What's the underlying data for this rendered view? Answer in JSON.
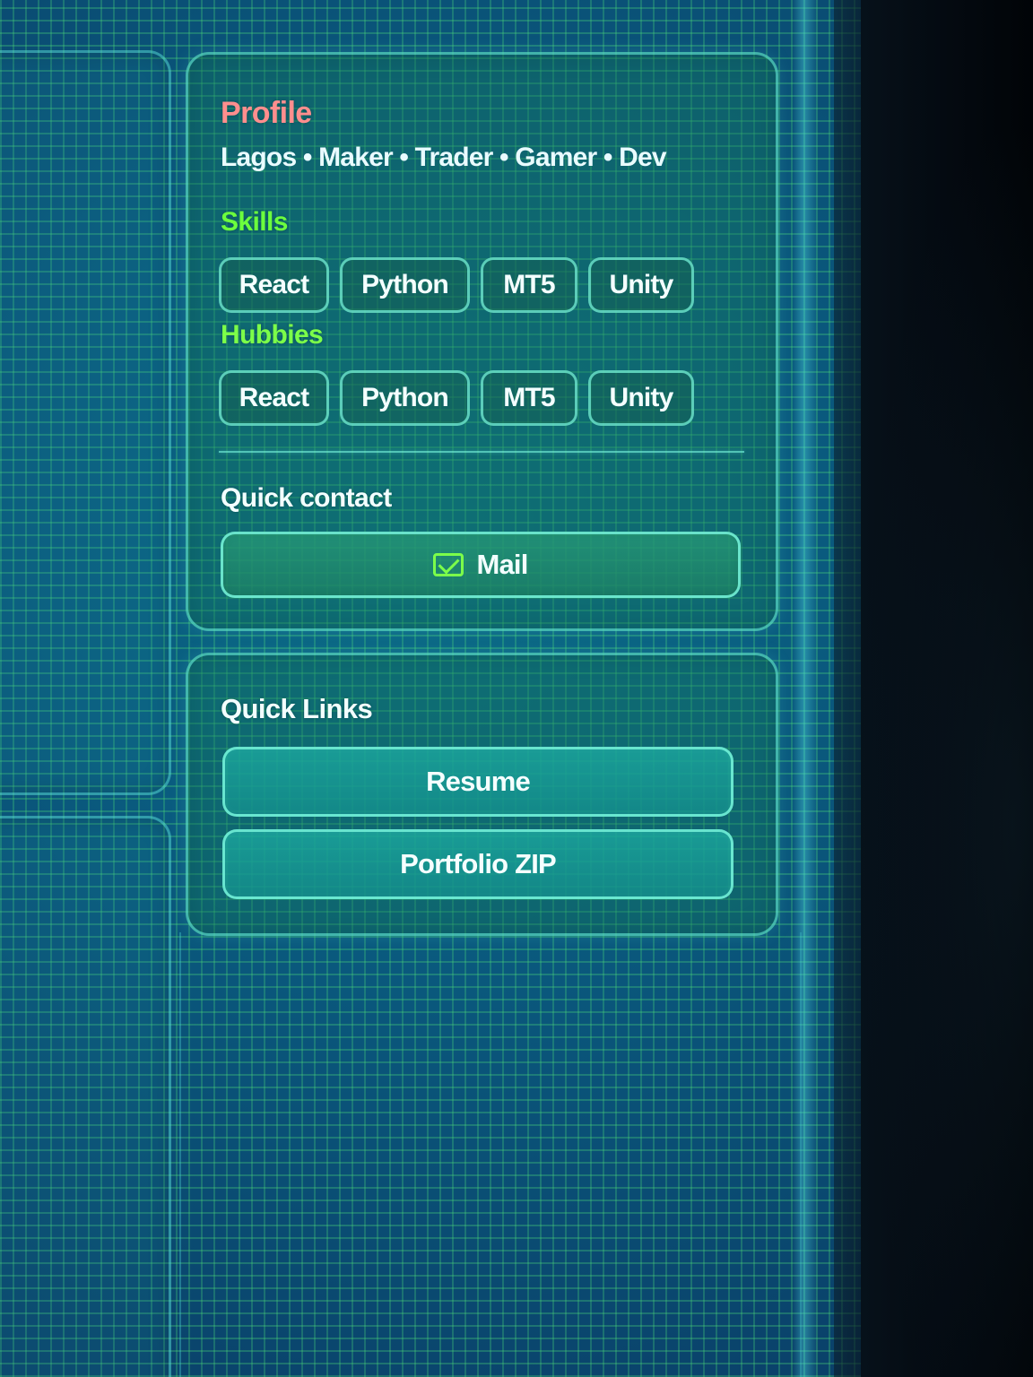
{
  "profile": {
    "title": "Profile",
    "tagline": "Lagos • Maker • Trader • Gamer • Dev",
    "skills_title": "Skills",
    "skills": [
      "React",
      "Python",
      "MT5",
      "Unity"
    ],
    "hobbies_title": "Hubbies",
    "hobbies": [
      "React",
      "Python",
      "MT5",
      "Unity"
    ],
    "quick_contact_title": "Quick contact",
    "mail_label": "Mail"
  },
  "quick_links": {
    "title": "Quick Links",
    "resume_label": "Resume",
    "portfolio_label": "Portfolio ZIP"
  },
  "colors": {
    "profile_title": "#ff8e8e",
    "section_green": "#6cff3d",
    "accent_border": "#78f5dc",
    "panel_fill": "#16785a",
    "link_fill": "#1ca8a0",
    "mail_icon": "#7cff4a"
  },
  "icons": {
    "mail": "mail-icon"
  }
}
